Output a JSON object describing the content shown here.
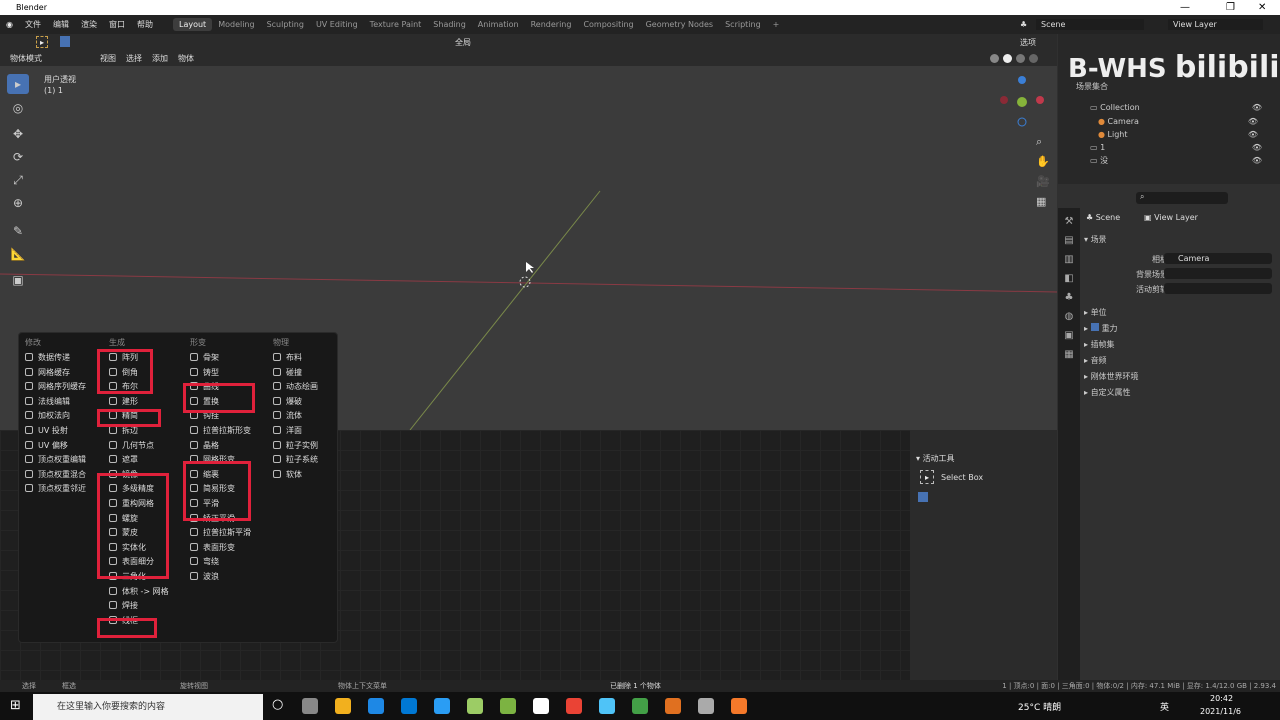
{
  "window": {
    "title": "Blender",
    "min": "—",
    "max": "❐",
    "close": "✕"
  },
  "menubar": {
    "items": [
      "文件",
      "编辑",
      "渲染",
      "窗口",
      "帮助"
    ],
    "workspaces": [
      "Layout",
      "Modeling",
      "Sculpting",
      "UV Editing",
      "Texture Paint",
      "Shading",
      "Animation",
      "Rendering",
      "Compositing",
      "Geometry Nodes",
      "Scripting"
    ],
    "active": "Layout",
    "add": "+",
    "scene": "Scene",
    "view_layer": "View Layer"
  },
  "toolheader": {
    "orientation": "全局",
    "options": "选项"
  },
  "viewport_header": {
    "mode": "物体模式",
    "menus": [
      "视图",
      "选择",
      "添加",
      "物体"
    ]
  },
  "viewport": {
    "view_name": "用户透视",
    "object_info": "(1) 1"
  },
  "modifier_menu": {
    "columns": [
      {
        "title": "修改",
        "items": [
          "数据传递",
          "网格缓存",
          "网格序列缓存",
          "法线编辑",
          "加权法向",
          "UV 投射",
          "UV 偏移",
          "顶点权重编辑",
          "顶点权重混合",
          "顶点权重邻近"
        ]
      },
      {
        "title": "生成",
        "items": [
          "阵列",
          "倒角",
          "布尔",
          "建形",
          "精简",
          "拆边",
          "几何节点",
          "遮罩",
          "镜像",
          "多级精度",
          "重构网格",
          "螺旋",
          "蒙皮",
          "实体化",
          "表面细分",
          "三角化",
          "体积 -> 网格",
          "焊接",
          "线框"
        ]
      },
      {
        "title": "形变",
        "items": [
          "骨架",
          "铸型",
          "曲线",
          "置换",
          "钩挂",
          "拉普拉斯形变",
          "晶格",
          "网格形变",
          "缩裹",
          "简易形变",
          "平滑",
          "矫正平滑",
          "拉普拉斯平滑",
          "表面形变",
          "弯绕",
          "波浪"
        ]
      },
      {
        "title": "物理",
        "items": [
          "布料",
          "碰撞",
          "动态绘画",
          "爆破",
          "流体",
          "洋面",
          "粒子实例",
          "粒子系统",
          "软体"
        ]
      }
    ],
    "highlight_color": "#e0213b"
  },
  "outliner": {
    "root": "场景集合",
    "items": [
      {
        "label": "Collection",
        "level": 0
      },
      {
        "label": "Camera",
        "level": 1
      },
      {
        "label": "Light",
        "level": 1
      },
      {
        "label": "1",
        "level": 0
      },
      {
        "label": "没",
        "level": 0
      }
    ]
  },
  "watermark": {
    "text": "B-WHS",
    "logo": "bilibili"
  },
  "properties": {
    "tabs": [
      "Scene",
      "View Layer"
    ],
    "section": "场景",
    "fields": [
      {
        "label": "相机",
        "value": "Camera"
      },
      {
        "label": "背景场景",
        "value": ""
      },
      {
        "label": "活动剪辑",
        "value": ""
      }
    ],
    "panels": [
      "单位",
      "重力",
      "插帧集",
      "音频",
      "刚体世界环境",
      "自定义属性"
    ],
    "gravity_checked": true
  },
  "active_tool": {
    "title": "活动工具",
    "tool": "Select Box"
  },
  "statusbar": {
    "select": "选择",
    "box": "框选",
    "rotate": "旋转视图",
    "context": "物体上下文菜单",
    "message": "已删除 1 个物体",
    "stats": "1 | 顶点:0 | 面:0 | 三角面:0 | 物体:0/2 | 内存: 47.1 MiB | 显存: 1.4/12.0 GB | 2.93.4"
  },
  "taskbar": {
    "search_placeholder": "在这里输入你要搜索的内容",
    "weather": "25°C 晴朗",
    "ime": "英",
    "time": "20:42",
    "date": "2021/11/6"
  },
  "colors": {
    "accent": "#4772b3",
    "x_axis": "#c0394b",
    "y_axis": "#86b33a",
    "z_axis": "#3b7fd6"
  }
}
